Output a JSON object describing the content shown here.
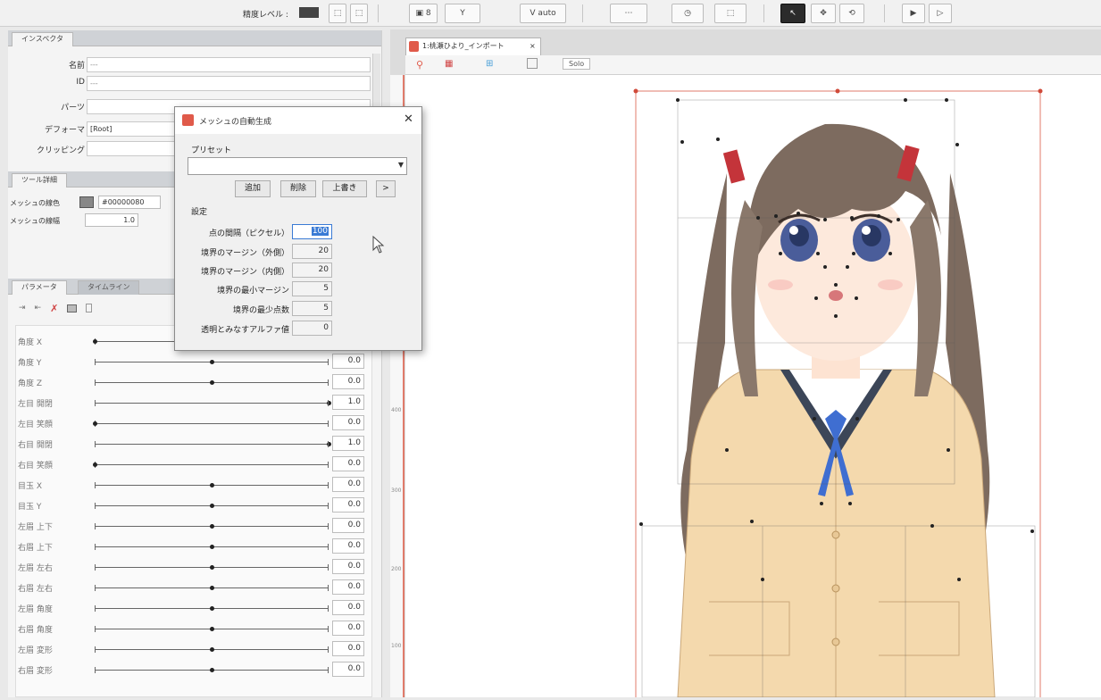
{
  "toolbar": {
    "display_level_label": "精度レベル :",
    "buttons": [
      "⬚",
      "⬚",
      "▣ 8",
      "Y",
      "V auto",
      "⋯",
      "◷",
      "⬚",
      "↖",
      "✥",
      "⟲",
      "▶",
      "▷"
    ]
  },
  "inspector": {
    "tab_label": "インスペクタ",
    "fields": [
      {
        "label": "名前",
        "value": "---"
      },
      {
        "label": "ID",
        "value": "---"
      },
      {
        "label": "パーツ",
        "value": ""
      },
      {
        "label": "デフォーマ",
        "value": "[Root]"
      },
      {
        "label": "クリッピング",
        "value": ""
      }
    ]
  },
  "tool_detail": {
    "tab_label": "ツール詳細",
    "mesh_color_label": "メッシュの線色",
    "mesh_color_value": "#00000080",
    "mesh_width_label": "メッシュの線幅",
    "mesh_width_value": "1.0"
  },
  "param_panel": {
    "tabs": [
      "パラメータ",
      "タイムライン"
    ],
    "params": [
      {
        "name": "角度 X",
        "pos": 0.0,
        "value": ""
      },
      {
        "name": "角度 Y",
        "pos": 0.5,
        "value": "0.0"
      },
      {
        "name": "角度 Z",
        "pos": 0.5,
        "value": "0.0"
      },
      {
        "name": "左目 開閉",
        "pos": 1.0,
        "value": "1.0"
      },
      {
        "name": "左目 笑顔",
        "pos": 0.0,
        "value": "0.0"
      },
      {
        "name": "右目 開閉",
        "pos": 1.0,
        "value": "1.0"
      },
      {
        "name": "右目 笑顔",
        "pos": 0.0,
        "value": "0.0"
      },
      {
        "name": "目玉 X",
        "pos": 0.5,
        "value": "0.0"
      },
      {
        "name": "目玉 Y",
        "pos": 0.5,
        "value": "0.0"
      },
      {
        "name": "左眉 上下",
        "pos": 0.5,
        "value": "0.0"
      },
      {
        "name": "右眉 上下",
        "pos": 0.5,
        "value": "0.0"
      },
      {
        "name": "左眉 左右",
        "pos": 0.5,
        "value": "0.0"
      },
      {
        "name": "右眉 左右",
        "pos": 0.5,
        "value": "0.0"
      },
      {
        "name": "左眉 角度",
        "pos": 0.5,
        "value": "0.0"
      },
      {
        "name": "右眉 角度",
        "pos": 0.5,
        "value": "0.0"
      },
      {
        "name": "左眉 変形",
        "pos": 0.5,
        "value": "0.0"
      },
      {
        "name": "右眉 変形",
        "pos": 0.5,
        "value": "0.0"
      }
    ]
  },
  "dialog": {
    "title": "メッシュの自動生成",
    "preset_label": "プリセット",
    "preset_value": "",
    "buttons": {
      "add": "追加",
      "delete": "削除",
      "overwrite": "上書き",
      "more": ">"
    },
    "settings_label": "設定",
    "settings": [
      {
        "label": "点の間隔（ピクセル）",
        "value": "100",
        "selected": true
      },
      {
        "label": "境界のマージン（外側）",
        "value": "20"
      },
      {
        "label": "境界のマージン（内側）",
        "value": "20"
      },
      {
        "label": "境界の最小マージン",
        "value": "5"
      },
      {
        "label": "境界の最少点数",
        "value": "5"
      },
      {
        "label": "透明とみなすアルファ値",
        "value": "0"
      }
    ],
    "close": "✕"
  },
  "canvas": {
    "doc_tab": "1:桃瀬ひより_インポート",
    "doc_tab_close": "×",
    "solo_label": "Solo",
    "ruler_marks": [
      "400",
      "300",
      "200",
      "100"
    ]
  },
  "colors": {
    "accent_red": "#e05a4a",
    "selection_blue": "#3a7bd5",
    "hair": "#7a6a5e",
    "cardigan": "#f4d7a8"
  }
}
